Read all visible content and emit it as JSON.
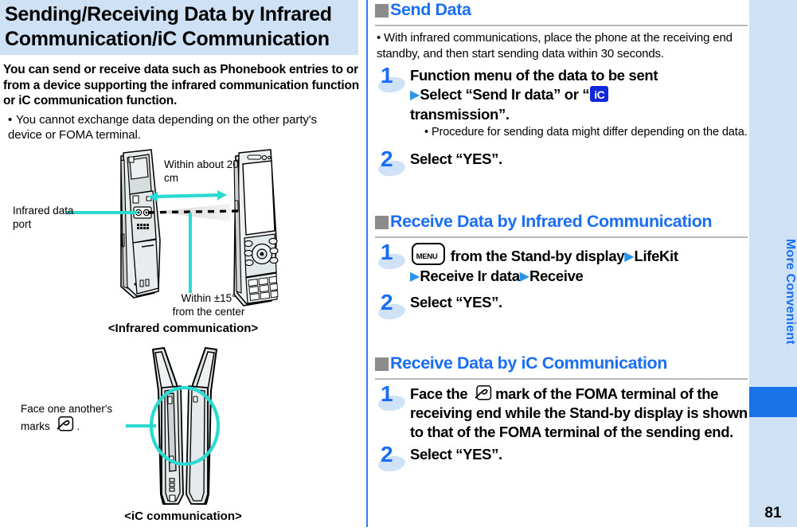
{
  "page_title": "Sending/Receiving Data by Infrared Communication/iC Communication",
  "intro": {
    "lead": "You can send or receive data such as Phonebook entries to or from a device supporting the infrared communication function or iC communication function.",
    "bullet": "You cannot exchange data depending on the other party's device or FOMA terminal."
  },
  "figures": {
    "infrared": {
      "caption": "<Infrared communication>",
      "label_port": "Infrared data port",
      "label_distance": "Within about 20 cm",
      "label_angle_line1": "Within ±15°",
      "label_angle_line2": "from the center"
    },
    "ic": {
      "caption": "<iC communication>",
      "label_marks_line1": "Face one another's",
      "label_marks_line2": "marks",
      "label_marks_end": "."
    }
  },
  "sections": [
    {
      "heading": "Send Data",
      "note": "With infrared communications, place the phone at the receiving end standby, and then start sending data within 30 seconds.",
      "steps": [
        {
          "num": "1",
          "text_a": "Function menu of the data to be sent",
          "text_b": "Select “Send Ir data” or “",
          "text_c": "transmission”.",
          "sub": "Procedure for sending data might differ depending on the data."
        },
        {
          "num": "2",
          "text_a": "Select “YES”."
        }
      ]
    },
    {
      "heading": "Receive Data by Infrared Communication",
      "steps": [
        {
          "num": "1",
          "text_a": "from the Stand-by display",
          "text_b": "LifeKit",
          "text_c": "Receive Ir data",
          "text_d": "Receive"
        },
        {
          "num": "2",
          "text_a": "Select “YES”."
        }
      ]
    },
    {
      "heading": "Receive Data by iC Communication",
      "steps": [
        {
          "num": "1",
          "text_a": "Face the",
          "text_b": "mark of the FOMA terminal of the receiving end while the Stand-by display is shown to that of the FOMA terminal of the sending end."
        },
        {
          "num": "2",
          "text_a": "Select “YES”."
        }
      ]
    }
  ],
  "sidebar": {
    "label": "More Convenient",
    "page_number": "81"
  },
  "colors": {
    "title_bg": "#cfe2f5",
    "heading_blue": "#1a6ef5",
    "divider_blue": "#2a7ef0",
    "sidebar_bg": "#cfe2f5",
    "sidebar_tab": "#1a72e8",
    "accent_cyan": "#2ad9d0",
    "ic_badge_blue": "#1228d8"
  }
}
